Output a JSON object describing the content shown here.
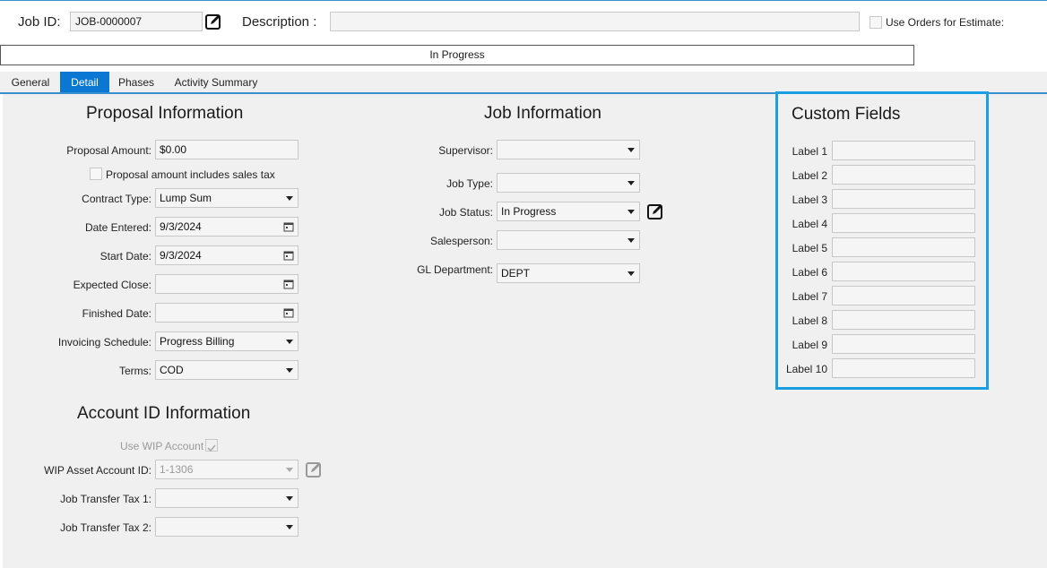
{
  "header": {
    "job_id_label": "Job ID:",
    "job_id_value": "JOB-0000007",
    "description_label": "Description :",
    "description_value": "",
    "use_orders_label": "Use Orders for Estimate:",
    "status_text": "In Progress"
  },
  "tabs": [
    {
      "label": "General"
    },
    {
      "label": "Detail"
    },
    {
      "label": "Phases"
    },
    {
      "label": "Activity Summary"
    }
  ],
  "proposal": {
    "title": "Proposal Information",
    "proposal_amount_label": "Proposal Amount:",
    "proposal_amount_value": "$0.00",
    "includes_tax_label": "Proposal amount includes sales tax",
    "contract_type_label": "Contract Type:",
    "contract_type_value": "Lump Sum",
    "date_entered_label": "Date Entered:",
    "date_entered_value": "9/3/2024",
    "start_date_label": "Start Date:",
    "start_date_value": "9/3/2024",
    "expected_close_label": "Expected Close:",
    "expected_close_value": "",
    "finished_date_label": "Finished Date:",
    "finished_date_value": "",
    "invoicing_label": "Invoicing Schedule:",
    "invoicing_value": "Progress Billing",
    "terms_label": "Terms:",
    "terms_value": "COD"
  },
  "account": {
    "title": "Account ID Information",
    "use_wip_label": "Use WIP Account",
    "wip_asset_label": "WIP Asset Account ID:",
    "wip_asset_value": "1-1306",
    "transfer_tax1_label": "Job Transfer Tax 1:",
    "transfer_tax1_value": "",
    "transfer_tax2_label": "Job Transfer Tax 2:",
    "transfer_tax2_value": ""
  },
  "job": {
    "title": "Job Information",
    "supervisor_label": "Supervisor:",
    "supervisor_value": "",
    "job_type_label": "Job Type:",
    "job_type_value": "",
    "job_status_label": "Job Status:",
    "job_status_value": "In Progress",
    "salesperson_label": "Salesperson:",
    "salesperson_value": "",
    "gl_department_label": "GL Department:",
    "gl_department_value": "DEPT"
  },
  "custom_fields": {
    "title": "Custom Fields",
    "labels": [
      "Label 1",
      "Label 2",
      "Label 3",
      "Label 4",
      "Label 5",
      "Label 6",
      "Label 7",
      "Label 8",
      "Label 9",
      "Label 10"
    ]
  },
  "colors": {
    "accent": "#0a78d2",
    "highlight_border": "#1a9fe3"
  },
  "icons": {
    "edit": "edit-icon",
    "calendar": "calendar-icon",
    "dropdown": "chevron-down-icon"
  }
}
